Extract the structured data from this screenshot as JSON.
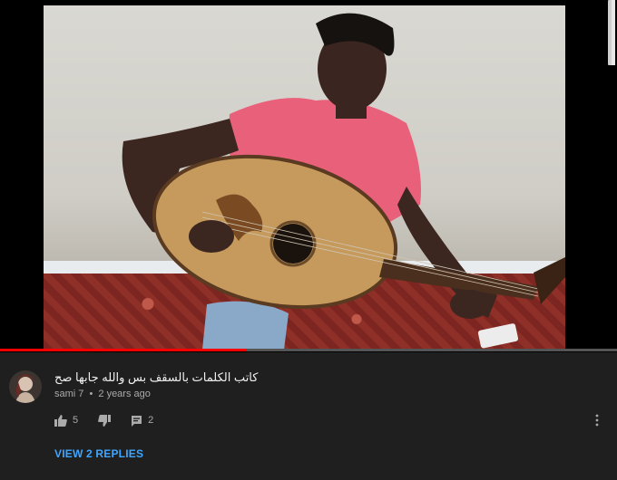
{
  "video": {
    "progress_percent": 40
  },
  "comment": {
    "text": "كاتب الكلمات بالسقف بس والله جابها صح",
    "author": "sami 7",
    "separator": "•",
    "time": "2 years ago",
    "likes": "5",
    "replies_count": "2",
    "view_replies_label": "VIEW 2 REPLIES",
    "icons": {
      "like": "thumb-up-icon",
      "dislike": "thumb-down-icon",
      "reply": "reply-icon",
      "more": "more-vert-icon"
    },
    "colors": {
      "link": "#3ea6ff",
      "progress": "#ff0000",
      "background": "#1f1f1f"
    }
  }
}
